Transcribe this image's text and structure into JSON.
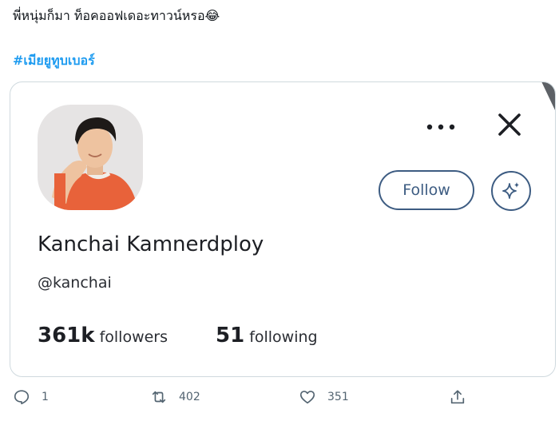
{
  "tweet": {
    "text": "พี่หนุ่มก็มา ท็อคออฟเดอะทาวน์หรอ😂",
    "hashtag": "#เมียยูทูบเบอร์"
  },
  "card": {
    "name": "Kanchai Kamnerdploy",
    "handle": "@kanchai",
    "follow_label": "Follow",
    "followers_count": "361k",
    "followers_label": "followers",
    "following_count": "51",
    "following_label": "following",
    "avatar_icon": "profile-photo",
    "accent": "#3d5c82"
  },
  "actions": {
    "reply_count": "1",
    "retweet_count": "402",
    "like_count": "351"
  }
}
